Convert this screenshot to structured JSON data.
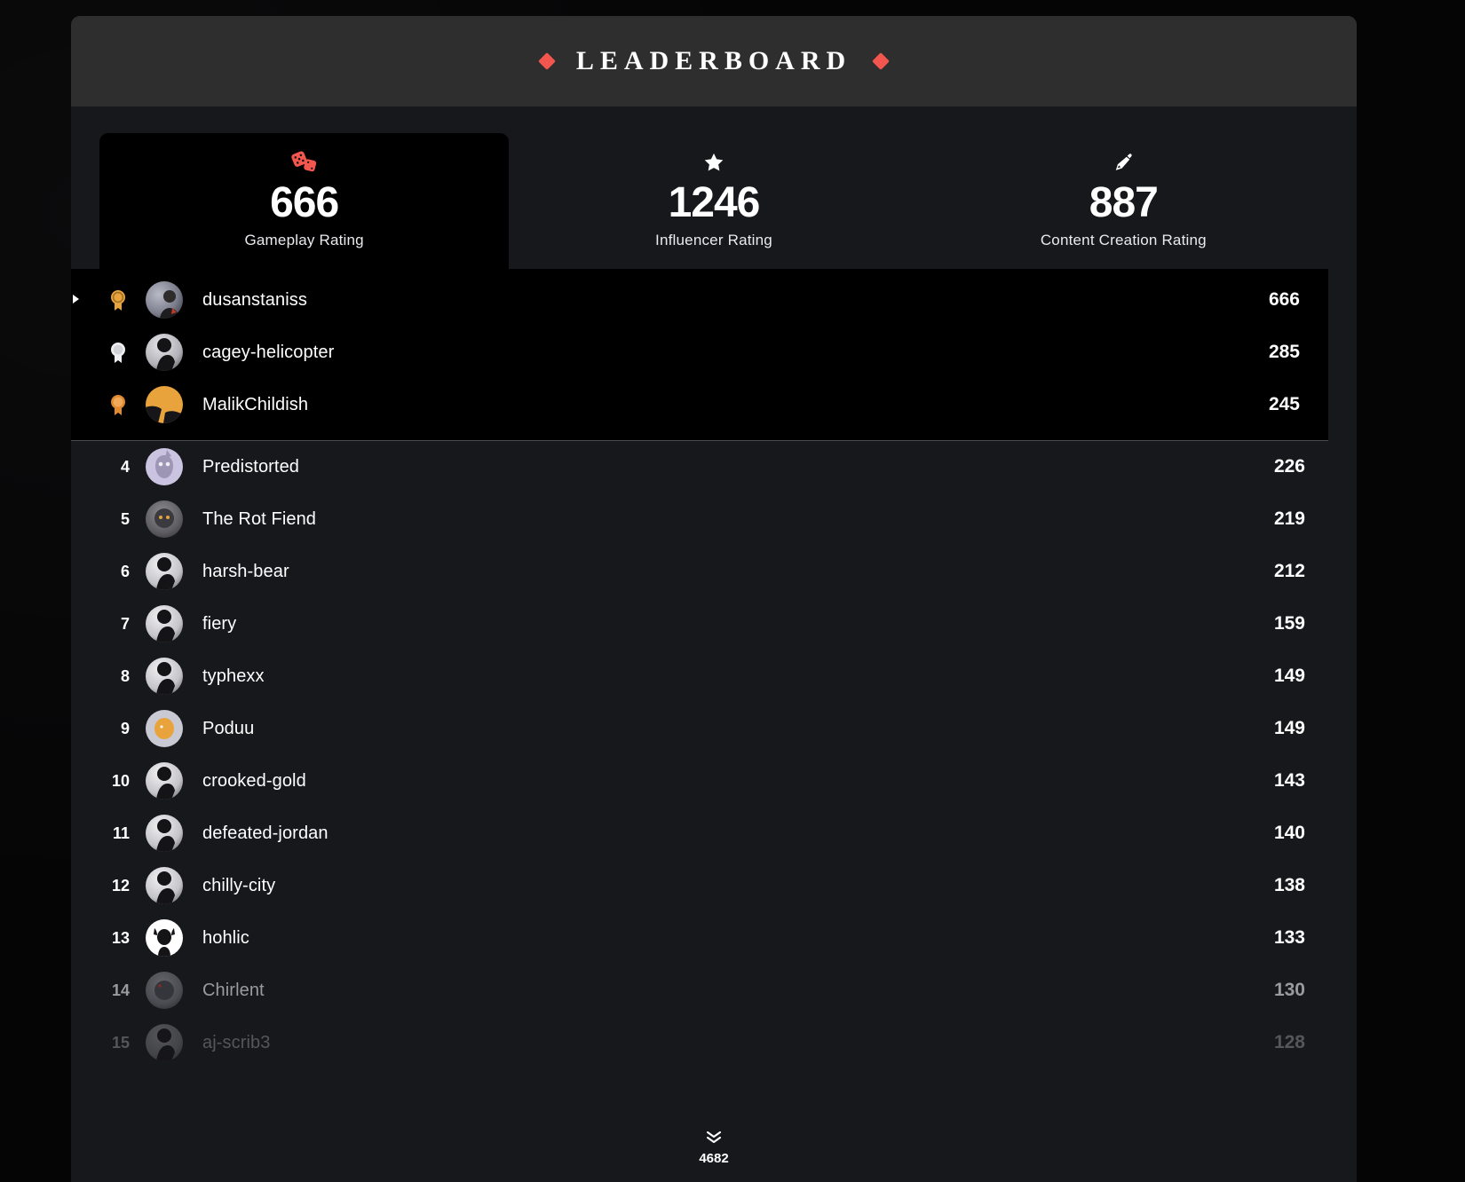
{
  "header": {
    "title": "LEADERBOARD",
    "left_diamond": "diamond-icon",
    "right_diamond": "diamond-icon"
  },
  "stats": [
    {
      "icon": "dice-icon",
      "value": "666",
      "label": "Gameplay Rating",
      "active": true
    },
    {
      "icon": "star-icon",
      "value": "1246",
      "label": "Influencer Rating",
      "active": false
    },
    {
      "icon": "pen-nib-icon",
      "value": "887",
      "label": "Content Creation Rating",
      "active": false
    }
  ],
  "podium": [
    {
      "rank": "1",
      "medal": "gold-medal-icon",
      "name": "dusanstaniss",
      "score": "666"
    },
    {
      "rank": "2",
      "medal": "silver-medal-icon",
      "name": "cagey-helicopter",
      "score": "285"
    },
    {
      "rank": "3",
      "medal": "bronze-medal-icon",
      "name": "MalikChildish",
      "score": "245"
    }
  ],
  "rows": [
    {
      "rank": "4",
      "name": "Predistorted",
      "score": "226"
    },
    {
      "rank": "5",
      "name": "The Rot Fiend",
      "score": "219"
    },
    {
      "rank": "6",
      "name": "harsh-bear",
      "score": "212"
    },
    {
      "rank": "7",
      "name": "fiery",
      "score": "159"
    },
    {
      "rank": "8",
      "name": "typhexx",
      "score": "149"
    },
    {
      "rank": "9",
      "name": "Poduu",
      "score": "149"
    },
    {
      "rank": "10",
      "name": "crooked-gold",
      "score": "143"
    },
    {
      "rank": "11",
      "name": "defeated-jordan",
      "score": "140"
    },
    {
      "rank": "12",
      "name": "chilly-city",
      "score": "138"
    },
    {
      "rank": "13",
      "name": "hohlic",
      "score": "133"
    },
    {
      "rank": "14",
      "name": "Chirlent",
      "score": "130"
    },
    {
      "rank": "15",
      "name": "aj-scrib3",
      "score": "128"
    }
  ],
  "footer": {
    "expand_icon": "chevron-double-down-icon",
    "total_count": "4682"
  },
  "colors": {
    "accent": "#f2564f",
    "page_bg": "#050506",
    "panel_bg": "#17181c",
    "header_bg": "#2e2e2e",
    "podium_bg": "#000000",
    "gold": "#e8a33d",
    "silver": "#d8d8dc",
    "bronze": "#e0892f"
  }
}
